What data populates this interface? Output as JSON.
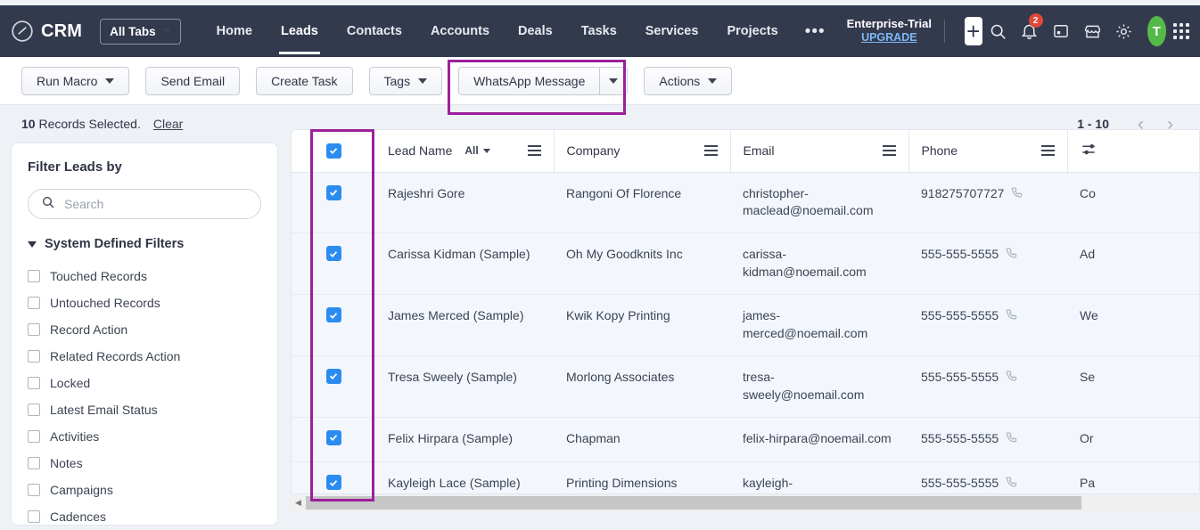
{
  "app": {
    "brand": "CRM",
    "brand_icon": "crm-logo-icon",
    "all_tabs_label": "All Tabs"
  },
  "nav": {
    "links": [
      {
        "label": "Home",
        "active": false
      },
      {
        "label": "Leads",
        "active": true
      },
      {
        "label": "Contacts",
        "active": false
      },
      {
        "label": "Accounts",
        "active": false
      },
      {
        "label": "Deals",
        "active": false
      },
      {
        "label": "Tasks",
        "active": false
      },
      {
        "label": "Services",
        "active": false
      },
      {
        "label": "Projects",
        "active": false
      }
    ],
    "more": "•••",
    "trial_name": "Enterprise-Trial",
    "trial_upgrade": "UPGRADE",
    "plus": "+",
    "notification_count": "2",
    "avatar_initial": "T"
  },
  "toolbar": {
    "run_macro": "Run Macro",
    "send_email": "Send Email",
    "create_task": "Create Task",
    "tags": "Tags",
    "whatsapp_message": "WhatsApp Message",
    "actions": "Actions"
  },
  "selection": {
    "count": "10",
    "count_text": "Records Selected.",
    "clear": "Clear",
    "page_range": "1 - 10",
    "prev": "‹",
    "next": "›"
  },
  "sidebar": {
    "title": "Filter Leads by",
    "search_placeholder": "Search",
    "search_value": "",
    "group_label": "System Defined Filters",
    "items": [
      {
        "label": "Touched Records"
      },
      {
        "label": "Untouched Records"
      },
      {
        "label": "Record Action"
      },
      {
        "label": "Related Records Action"
      },
      {
        "label": "Locked"
      },
      {
        "label": "Latest Email Status"
      },
      {
        "label": "Activities"
      },
      {
        "label": "Notes"
      },
      {
        "label": "Campaigns"
      },
      {
        "label": "Cadences"
      }
    ]
  },
  "table": {
    "columns": [
      {
        "label": "Lead Name",
        "filter": "All"
      },
      {
        "label": "Company"
      },
      {
        "label": "Email"
      },
      {
        "label": "Phone"
      }
    ],
    "rows": [
      {
        "name": "Rajeshri Gore",
        "company": "Rangoni Of Florence",
        "email": "christopher-maclead@noemail.com",
        "phone": "918275707727",
        "last": "Co"
      },
      {
        "name": "Carissa Kidman (Sample)",
        "company": "Oh My Goodknits Inc",
        "email": "carissa-kidman@noemail.com",
        "phone": "555-555-5555",
        "last": "Ad"
      },
      {
        "name": "James Merced (Sample)",
        "company": "Kwik Kopy Printing",
        "email": "james-merced@noemail.com",
        "phone": "555-555-5555",
        "last": "We"
      },
      {
        "name": "Tresa Sweely (Sample)",
        "company": "Morlong Associates",
        "email": "tresa-sweely@noemail.com",
        "phone": "555-555-5555",
        "last": "Se"
      },
      {
        "name": "Felix Hirpara (Sample)",
        "company": "Chapman",
        "email": "felix-hirpara@noemail.com",
        "phone": "555-555-5555",
        "last": "Or"
      },
      {
        "name": "Kayleigh Lace (Sample)",
        "company": "Printing Dimensions",
        "email": "kayleigh-lace@noemail.com",
        "phone": "555-555-5555",
        "last": "Pa"
      }
    ]
  },
  "colors": {
    "nav_bg": "#333a4d",
    "page_bg": "#eef1f6",
    "highlight": "#9c1f9c",
    "checkbox": "#2b8cf0",
    "row_selected": "#f3f7fd",
    "avatar": "#55b947",
    "badge": "#e0483c",
    "upgrade_link": "#7eb6f5"
  }
}
